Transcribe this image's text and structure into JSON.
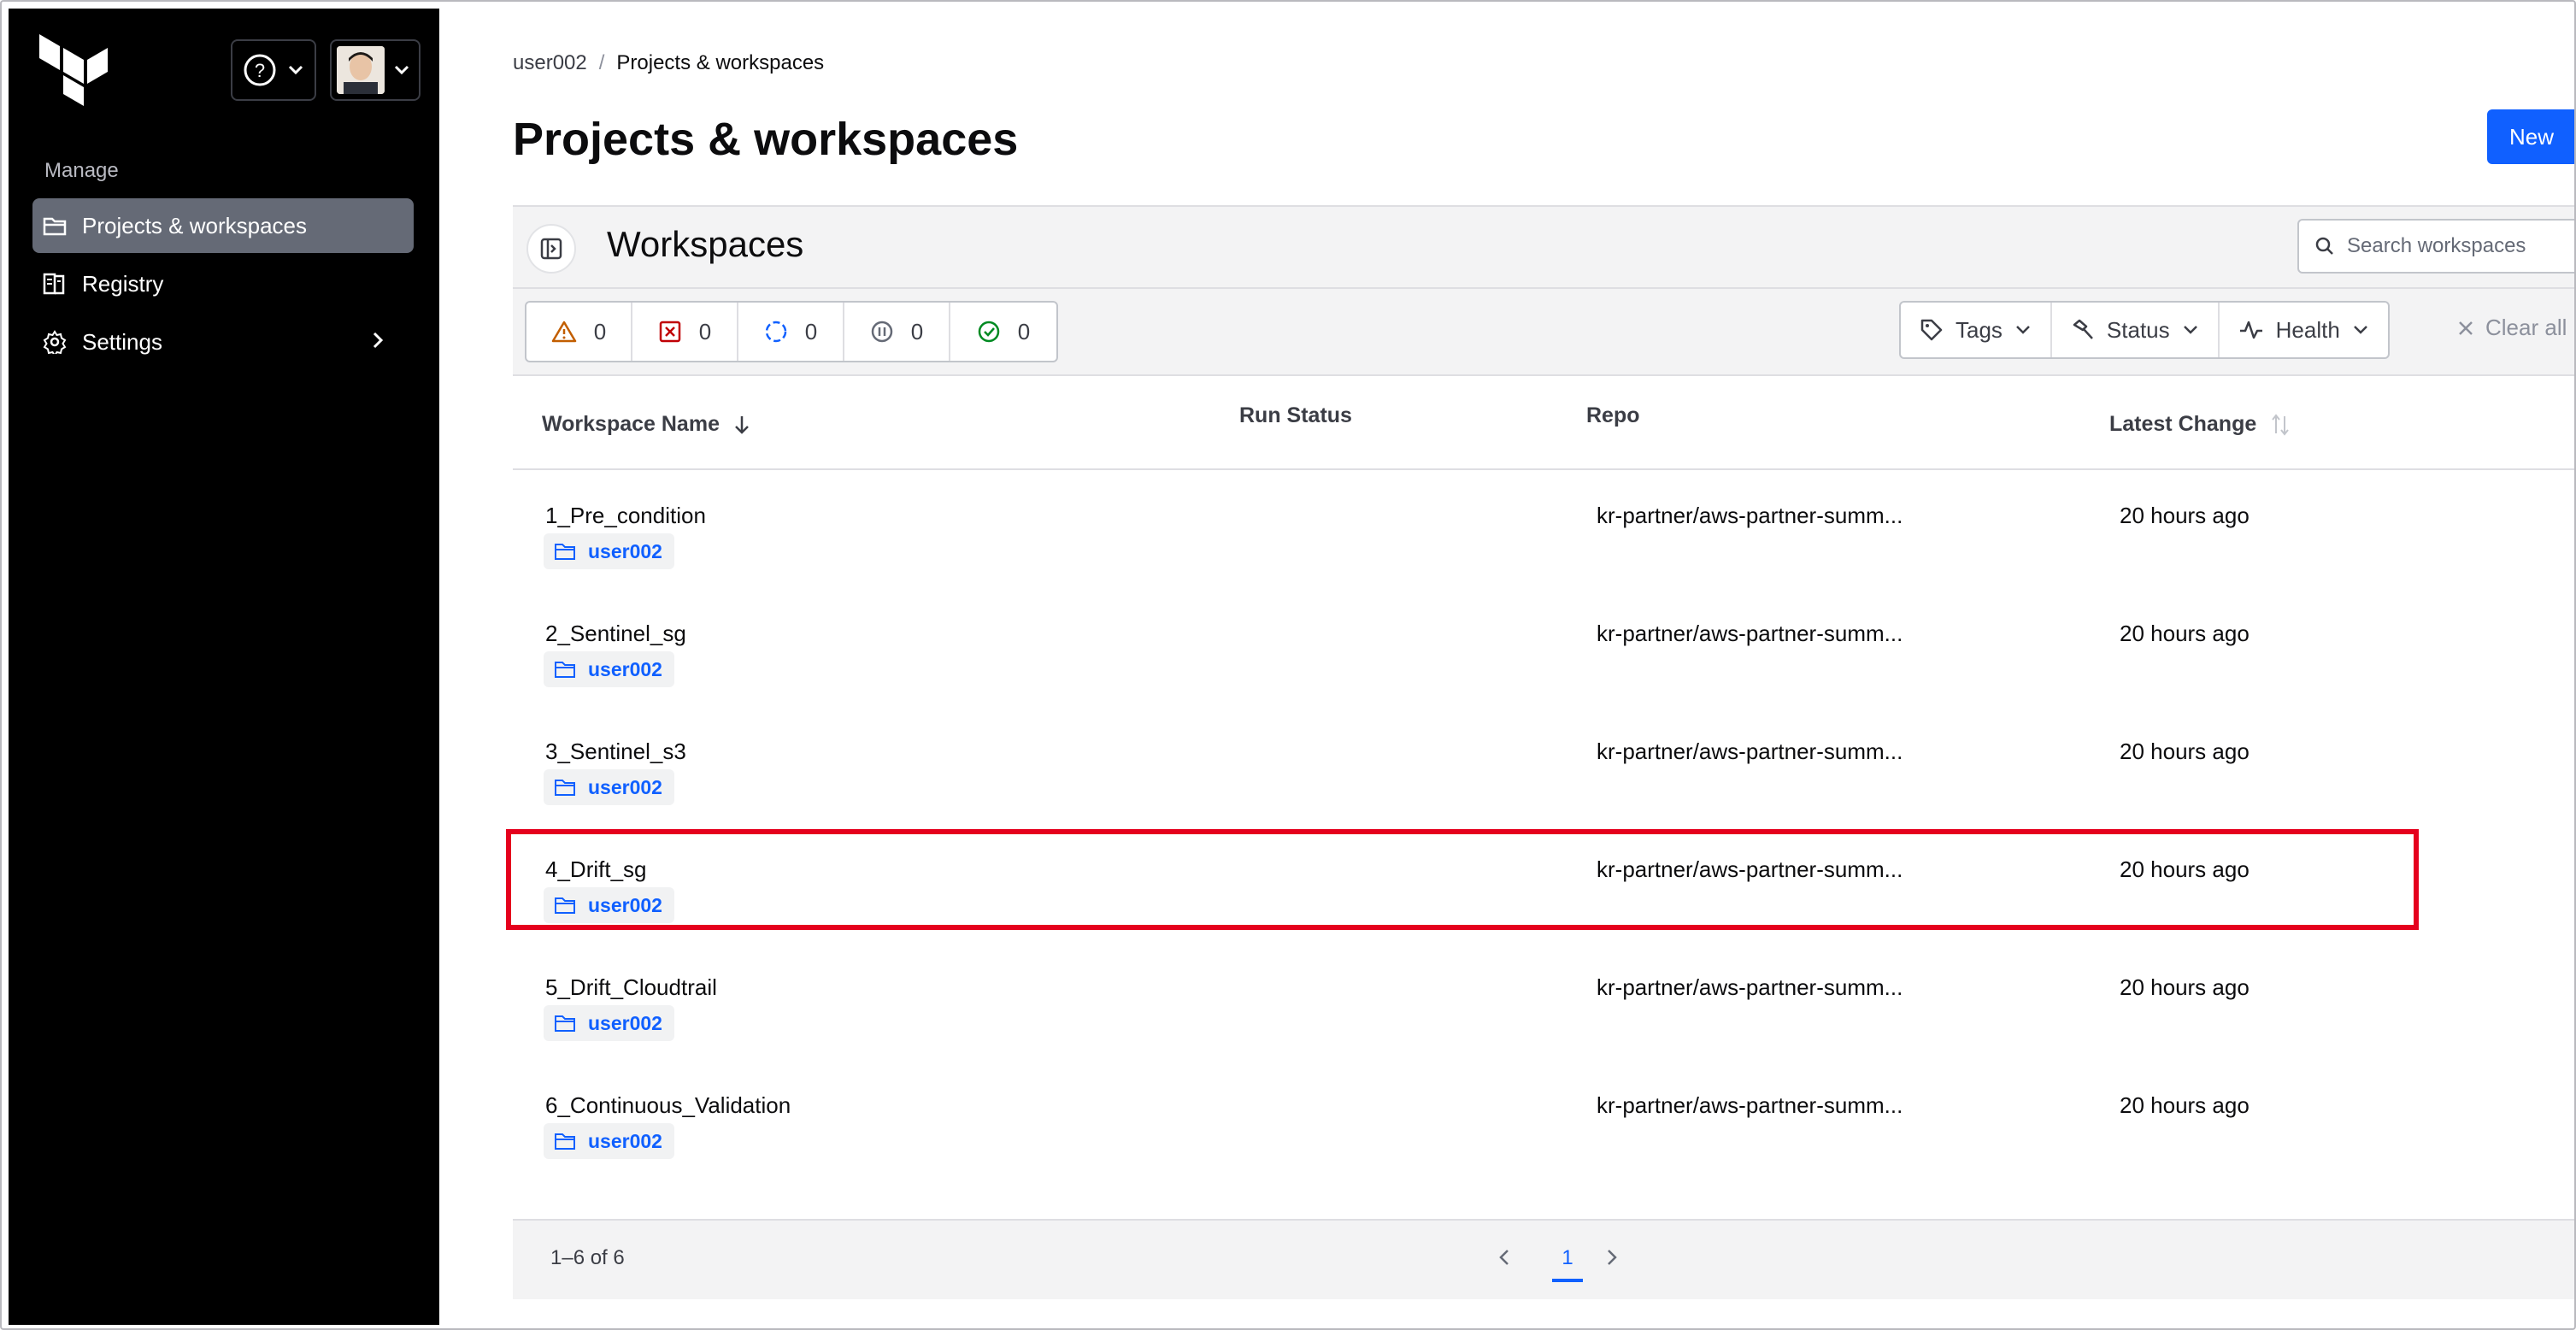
{
  "sidebar": {
    "manage_label": "Manage",
    "items": [
      {
        "label": "Projects & workspaces",
        "icon": "folder-icon",
        "active": true
      },
      {
        "label": "Registry",
        "icon": "registry-icon"
      },
      {
        "label": "Settings",
        "icon": "gear-icon"
      }
    ]
  },
  "breadcrumb": {
    "org": "user002",
    "sep": "/",
    "current": "Projects & workspaces"
  },
  "page": {
    "title": "Projects & workspaces",
    "new_label": "New"
  },
  "workspaces": {
    "title": "Workspaces",
    "search_placeholder": "Search workspaces",
    "counts": [
      {
        "icon": "warning-icon",
        "value": "0",
        "color": "#c25e00"
      },
      {
        "icon": "error-icon",
        "value": "0",
        "color": "#c00005"
      },
      {
        "icon": "running-icon",
        "value": "0",
        "color": "#1060ff"
      },
      {
        "icon": "paused-icon",
        "value": "0",
        "color": "#656a76"
      },
      {
        "icon": "success-icon",
        "value": "0",
        "color": "#008a22"
      }
    ],
    "filters": {
      "tags": "Tags",
      "status": "Status",
      "health": "Health",
      "clear_all": "Clear all"
    },
    "columns": {
      "name": "Workspace Name",
      "run_status": "Run Status",
      "repo": "Repo",
      "latest_change": "Latest Change"
    },
    "rows": [
      {
        "name": "1_Pre_condition",
        "project": "user002",
        "repo": "kr-partner/aws-partner-summ...",
        "latest_change": "20 hours ago"
      },
      {
        "name": "2_Sentinel_sg",
        "project": "user002",
        "repo": "kr-partner/aws-partner-summ...",
        "latest_change": "20 hours ago"
      },
      {
        "name": "3_Sentinel_s3",
        "project": "user002",
        "repo": "kr-partner/aws-partner-summ...",
        "latest_change": "20 hours ago"
      },
      {
        "name": "4_Drift_sg",
        "project": "user002",
        "repo": "kr-partner/aws-partner-summ...",
        "latest_change": "20 hours ago"
      },
      {
        "name": "5_Drift_Cloudtrail",
        "project": "user002",
        "repo": "kr-partner/aws-partner-summ...",
        "latest_change": "20 hours ago"
      },
      {
        "name": "6_Continuous_Validation",
        "project": "user002",
        "repo": "kr-partner/aws-partner-summ...",
        "latest_change": "20 hours ago"
      }
    ],
    "pagination": {
      "range": "1–6 of 6",
      "current_page": "1"
    }
  },
  "colors": {
    "accent": "#1060ff",
    "sidebar_bg": "#000000",
    "highlight": "#e5001d"
  }
}
